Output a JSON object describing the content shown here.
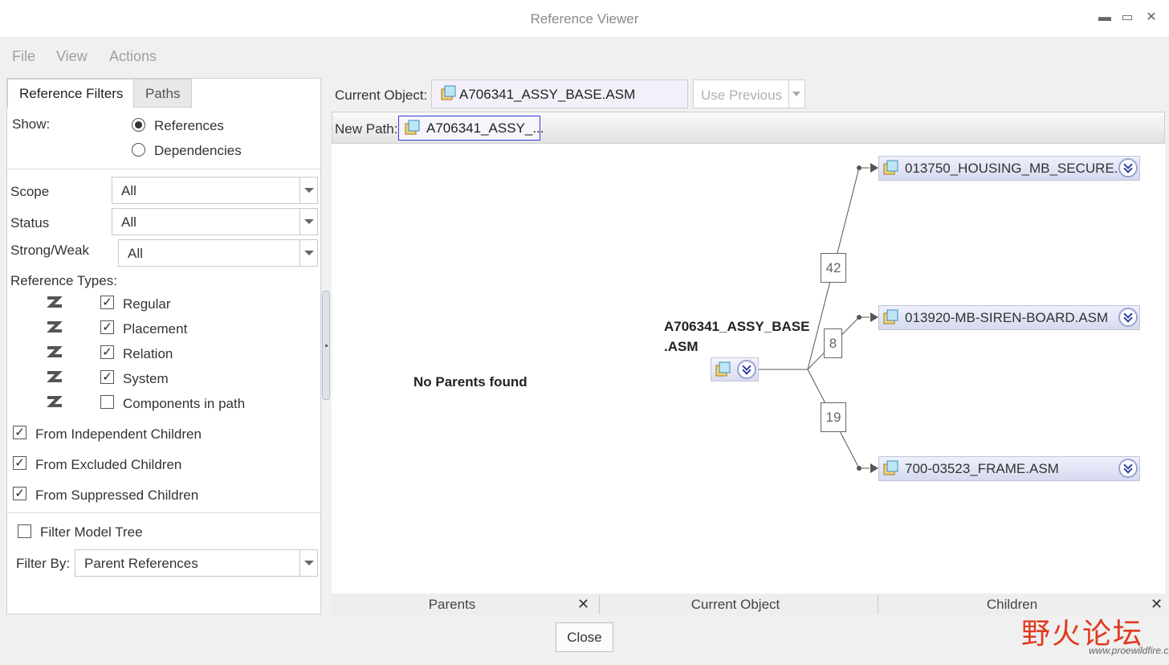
{
  "window": {
    "title": "Reference Viewer",
    "minimize": "▬",
    "maximize": "▭",
    "close": "✕"
  },
  "menu": [
    "File",
    "View",
    "Actions"
  ],
  "left_tabs": [
    "Reference Filters",
    "Paths"
  ],
  "show": {
    "label": "Show:",
    "options": [
      "References",
      "Dependencies"
    ],
    "selected": "References"
  },
  "filters": {
    "scope": {
      "label": "Scope",
      "value": "All"
    },
    "status": {
      "label": "Status",
      "value": "All"
    },
    "strong_weak": {
      "label": "Strong/Weak",
      "value": "All"
    }
  },
  "reference_types": {
    "label": "Reference Types:",
    "items": [
      {
        "label": "Regular",
        "checked": "✓"
      },
      {
        "label": "Placement",
        "checked": "✓"
      },
      {
        "label": "Relation",
        "checked": "✓"
      },
      {
        "label": "System",
        "checked": "✓"
      },
      {
        "label": "Components in path",
        "checked": ""
      }
    ]
  },
  "from_options": [
    {
      "label": "From Independent Children",
      "checked": "✓"
    },
    {
      "label": "From Excluded Children",
      "checked": "✓"
    },
    {
      "label": "From Suppressed Children",
      "checked": "✓"
    }
  ],
  "filter_model_tree": {
    "label": "Filter Model Tree",
    "checked": ""
  },
  "filter_by": {
    "label": "Filter By:",
    "value": "Parent References"
  },
  "current_object": {
    "label": "Current Object:",
    "value": "A706341_ASSY_BASE.ASM"
  },
  "use_previous": "Use Previous",
  "new_path": {
    "label": "New Path:",
    "value": "A706341_ASSY_..."
  },
  "graph": {
    "no_parents": "No Parents found",
    "center_line1": "A706341_ASSY_BASE",
    "center_line2": ".ASM",
    "children": [
      {
        "name": "013750_HOUSING_MB_SECURE...",
        "count": "42"
      },
      {
        "name": "013920-MB-SIREN-BOARD.ASM",
        "count": "8"
      },
      {
        "name": "700-03523_FRAME.ASM",
        "count": "19"
      }
    ],
    "line_color": "#555555"
  },
  "bottom_tabs": [
    "Parents",
    "Current Object",
    "Children"
  ],
  "bottom_close": "✕",
  "close_button": "Close",
  "watermark": {
    "chinese": "野火论坛",
    "url": "www.proewildfire.cn"
  },
  "colors": {
    "accent_blue": "#2b3e9b",
    "node_fill": "#d6daf0",
    "watermark_red": "#e03a20"
  }
}
